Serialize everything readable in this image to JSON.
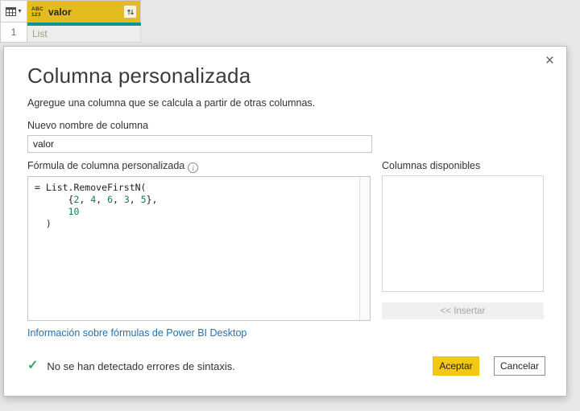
{
  "colors": {
    "accent_yellow": "#f2c811",
    "header_yellow": "#e4bc1d",
    "teal_selection": "#10948c",
    "link_blue": "#2172b8",
    "check_green": "#3ba55d",
    "code_number_teal": "#0e7d62"
  },
  "grid": {
    "column_header": {
      "type_icon_top": "ABC",
      "type_icon_bottom": "123",
      "name": "valor",
      "sort_filter_icon": "sort-arrows",
      "dropdown_caret": "▾"
    },
    "rows": [
      {
        "number": "1",
        "value": "List"
      }
    ]
  },
  "dialog": {
    "title": "Columna personalizada",
    "subtitle": "Agregue una columna que se calcula a partir de otras columnas.",
    "close_glyph": "×",
    "name_field": {
      "label": "Nuevo nombre de columna",
      "value": "valor"
    },
    "formula_field": {
      "label": "Fórmula de columna personalizada",
      "info_glyph": "i",
      "code_lines": [
        [
          {
            "s": "= List.RemoveFirstN(",
            "t": "plain"
          }
        ],
        [
          {
            "s": "      {",
            "t": "plain"
          },
          {
            "s": "2",
            "t": "num"
          },
          {
            "s": ", ",
            "t": "plain"
          },
          {
            "s": "4",
            "t": "num"
          },
          {
            "s": ", ",
            "t": "plain"
          },
          {
            "s": "6",
            "t": "num"
          },
          {
            "s": ", ",
            "t": "plain"
          },
          {
            "s": "3",
            "t": "num"
          },
          {
            "s": ", ",
            "t": "plain"
          },
          {
            "s": "5",
            "t": "num"
          },
          {
            "s": "},",
            "t": "plain"
          }
        ],
        [
          {
            "s": "      ",
            "t": "plain"
          },
          {
            "s": "10",
            "t": "num"
          }
        ],
        [
          {
            "s": "  )",
            "t": "plain"
          }
        ]
      ]
    },
    "available_columns": {
      "label": "Columnas disponibles",
      "items": [],
      "insert_button_label": "<< Insertar"
    },
    "help_link": "Información sobre fórmulas de Power BI Desktop",
    "status": {
      "check_glyph": "✓",
      "text": "No se han detectado errores de sintaxis."
    },
    "buttons": {
      "ok": "Aceptar",
      "cancel": "Cancelar"
    }
  }
}
